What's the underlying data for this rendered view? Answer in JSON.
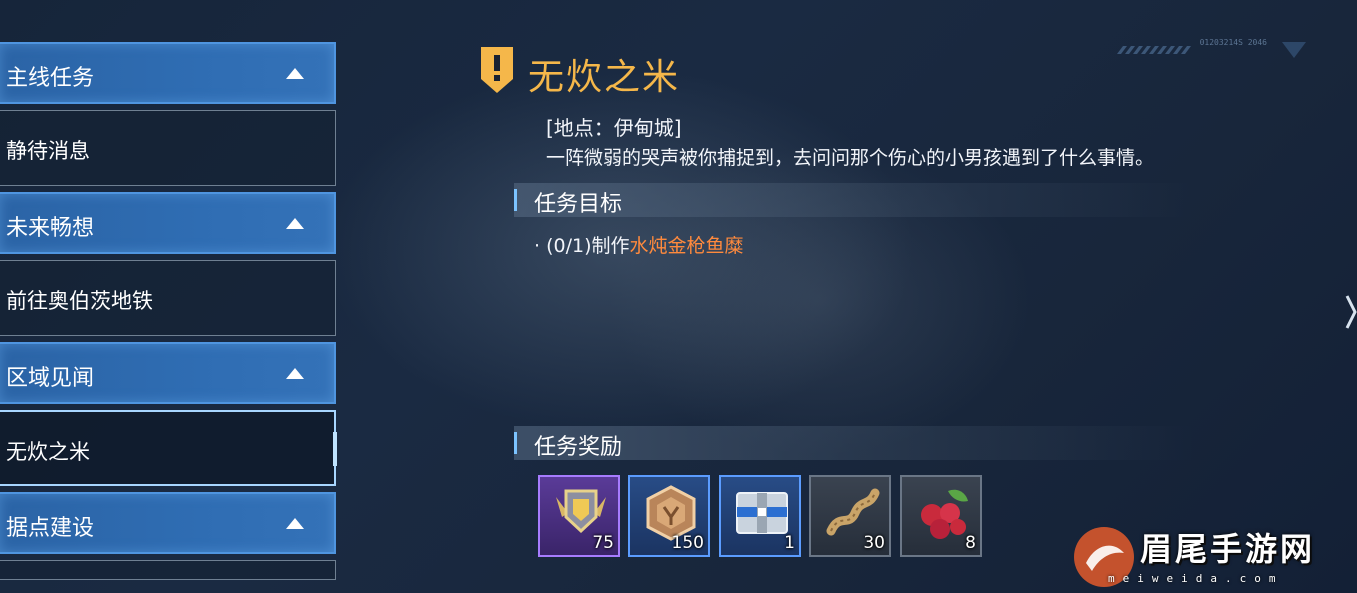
{
  "sidebar": {
    "groups": [
      {
        "category": "主线任务",
        "quest": "静待消息"
      },
      {
        "category": "未来畅想",
        "quest": "前往奥伯茨地铁"
      },
      {
        "category": "区域见闻",
        "quest": "无炊之米"
      },
      {
        "category": "据点建设",
        "quest": ""
      }
    ]
  },
  "quest": {
    "title": "无炊之米",
    "location": "[地点：伊甸城]",
    "description": "一阵微弱的哭声被你捕捉到，去问问那个伤心的小男孩遇到了什么事情。",
    "objectives_header": "任务目标",
    "objective_prefix": "· (0/1)制作",
    "objective_target": "水炖金枪鱼糜",
    "rewards_header": "任务奖励"
  },
  "rewards": [
    {
      "icon": "gold-badge-icon",
      "count": "75",
      "rarity": "purple"
    },
    {
      "icon": "bronze-medal-icon",
      "count": "150",
      "rarity": "blue"
    },
    {
      "icon": "supply-crate-icon",
      "count": "1",
      "rarity": "blue"
    },
    {
      "icon": "rope-icon",
      "count": "30",
      "rarity": "gray"
    },
    {
      "icon": "raspberry-icon",
      "count": "8",
      "rarity": "gray"
    }
  ],
  "decor": {
    "code": "01203214S 2046"
  },
  "watermark": {
    "text": "眉尾手游网",
    "url": "meiweida.com"
  },
  "colors": {
    "accent_gold": "#f5b74a",
    "highlight_orange": "#ff8a3d",
    "category_blue": "#2f6db3"
  }
}
